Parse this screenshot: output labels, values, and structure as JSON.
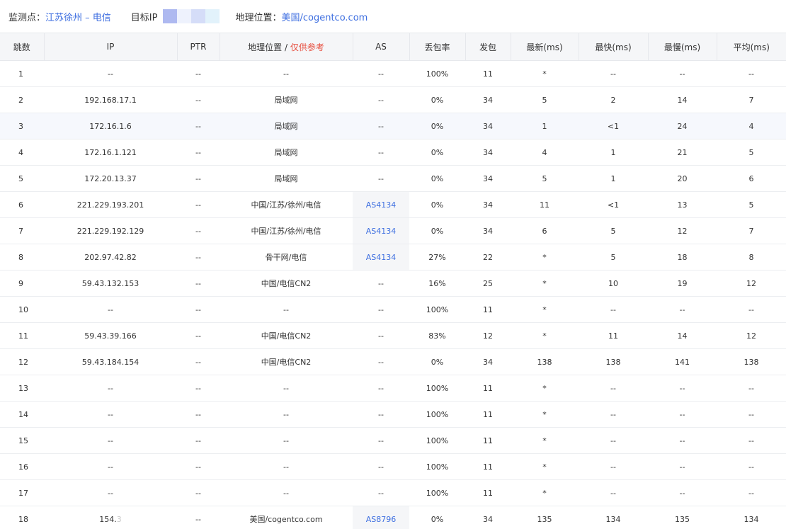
{
  "header": {
    "monitor_label": "监测点：",
    "monitor_value": "江苏徐州 – 电信",
    "target_label": "目标IP",
    "geo_label": "地理位置：",
    "geo_value": "美国/cogentco.com"
  },
  "columns": {
    "hop": "跳数",
    "ip": "IP",
    "ptr": "PTR",
    "geo": "地理位置",
    "geo_sep": " / ",
    "geo_ref": "仅供参考",
    "as": "AS",
    "loss": "丢包率",
    "sent": "发包",
    "last": "最新(ms)",
    "best": "最快(ms)",
    "worst": "最慢(ms)",
    "avg": "平均(ms)"
  },
  "rows": [
    {
      "hop": "1",
      "ip": "--",
      "ptr": "--",
      "geo": "--",
      "as": "--",
      "loss": "100%",
      "sent": "11",
      "last": "*",
      "best": "--",
      "worst": "--",
      "avg": "--"
    },
    {
      "hop": "2",
      "ip": "192.168.17.1",
      "ptr": "--",
      "geo": "局域网",
      "as": "--",
      "loss": "0%",
      "sent": "34",
      "last": "5",
      "best": "2",
      "worst": "14",
      "avg": "7"
    },
    {
      "hop": "3",
      "ip": "172.16.1.6",
      "ptr": "--",
      "geo": "局域网",
      "as": "--",
      "loss": "0%",
      "sent": "34",
      "last": "1",
      "best": "<1",
      "worst": "24",
      "avg": "4"
    },
    {
      "hop": "4",
      "ip": "172.16.1.121",
      "ptr": "--",
      "geo": "局域网",
      "as": "--",
      "loss": "0%",
      "sent": "34",
      "last": "4",
      "best": "1",
      "worst": "21",
      "avg": "5"
    },
    {
      "hop": "5",
      "ip": "172.20.13.37",
      "ptr": "--",
      "geo": "局域网",
      "as": "--",
      "loss": "0%",
      "sent": "34",
      "last": "5",
      "best": "1",
      "worst": "20",
      "avg": "6"
    },
    {
      "hop": "6",
      "ip": "221.229.193.201",
      "ptr": "--",
      "geo": "中国/江苏/徐州/电信",
      "as": "AS4134",
      "loss": "0%",
      "sent": "34",
      "last": "11",
      "best": "<1",
      "worst": "13",
      "avg": "5"
    },
    {
      "hop": "7",
      "ip": "221.229.192.129",
      "ptr": "--",
      "geo": "中国/江苏/徐州/电信",
      "as": "AS4134",
      "loss": "0%",
      "sent": "34",
      "last": "6",
      "best": "5",
      "worst": "12",
      "avg": "7"
    },
    {
      "hop": "8",
      "ip": "202.97.42.82",
      "ptr": "--",
      "geo": "骨干网/电信",
      "as": "AS4134",
      "loss": "27%",
      "sent": "22",
      "last": "*",
      "best": "5",
      "worst": "18",
      "avg": "8"
    },
    {
      "hop": "9",
      "ip": "59.43.132.153",
      "ptr": "--",
      "geo": "中国/电信CN2",
      "as": "--",
      "loss": "16%",
      "sent": "25",
      "last": "*",
      "best": "10",
      "worst": "19",
      "avg": "12"
    },
    {
      "hop": "10",
      "ip": "--",
      "ptr": "--",
      "geo": "--",
      "as": "--",
      "loss": "100%",
      "sent": "11",
      "last": "*",
      "best": "--",
      "worst": "--",
      "avg": "--"
    },
    {
      "hop": "11",
      "ip": "59.43.39.166",
      "ptr": "--",
      "geo": "中国/电信CN2",
      "as": "--",
      "loss": "83%",
      "sent": "12",
      "last": "*",
      "best": "11",
      "worst": "14",
      "avg": "12"
    },
    {
      "hop": "12",
      "ip": "59.43.184.154",
      "ptr": "--",
      "geo": "中国/电信CN2",
      "as": "--",
      "loss": "0%",
      "sent": "34",
      "last": "138",
      "best": "138",
      "worst": "141",
      "avg": "138"
    },
    {
      "hop": "13",
      "ip": "--",
      "ptr": "--",
      "geo": "--",
      "as": "--",
      "loss": "100%",
      "sent": "11",
      "last": "*",
      "best": "--",
      "worst": "--",
      "avg": "--"
    },
    {
      "hop": "14",
      "ip": "--",
      "ptr": "--",
      "geo": "--",
      "as": "--",
      "loss": "100%",
      "sent": "11",
      "last": "*",
      "best": "--",
      "worst": "--",
      "avg": "--"
    },
    {
      "hop": "15",
      "ip": "--",
      "ptr": "--",
      "geo": "--",
      "as": "--",
      "loss": "100%",
      "sent": "11",
      "last": "*",
      "best": "--",
      "worst": "--",
      "avg": "--"
    },
    {
      "hop": "16",
      "ip": "--",
      "ptr": "--",
      "geo": "--",
      "as": "--",
      "loss": "100%",
      "sent": "11",
      "last": "*",
      "best": "--",
      "worst": "--",
      "avg": "--"
    },
    {
      "hop": "17",
      "ip": "--",
      "ptr": "--",
      "geo": "--",
      "as": "--",
      "loss": "100%",
      "sent": "11",
      "last": "*",
      "best": "--",
      "worst": "--",
      "avg": "--"
    },
    {
      "hop": "18",
      "ip": "154.3",
      "ptr": "--",
      "geo": "美国/cogentco.com",
      "as": "AS8796",
      "loss": "0%",
      "sent": "34",
      "last": "135",
      "best": "134",
      "worst": "135",
      "avg": "134"
    }
  ],
  "colors": {
    "accent": "#3d6ee0",
    "reference_red": "#e74c3c",
    "header_bg": "#f5f6f8",
    "highlight_row": "#f6f8fd"
  }
}
